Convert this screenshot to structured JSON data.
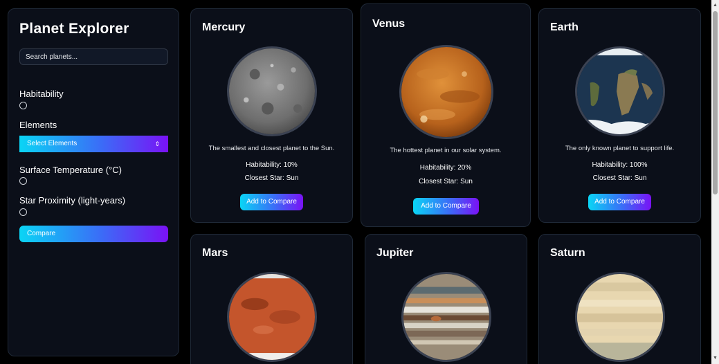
{
  "sidebar": {
    "title": "Planet Explorer",
    "search_placeholder": "Search planets...",
    "filters": {
      "habitability": "Habitability",
      "elements": "Elements",
      "elements_select": "Select Elements",
      "surface_temperature": "Surface Temperature (°C)",
      "star_proximity": "Star Proximity (light-years)"
    },
    "compare_label": "Compare"
  },
  "planets": [
    {
      "name": "Mercury",
      "description": "The smallest and closest planet to the Sun.",
      "habitability": "Habitability: 10%",
      "closest_star": "Closest Star: Sun",
      "button": "Add to Compare"
    },
    {
      "name": "Venus",
      "description": "The hottest planet in our solar system.",
      "habitability": "Habitability: 20%",
      "closest_star": "Closest Star: Sun",
      "button": "Add to Compare"
    },
    {
      "name": "Earth",
      "description": "The only known planet to support life.",
      "habitability": "Habitability: 100%",
      "closest_star": "Closest Star: Sun",
      "button": "Add to Compare"
    },
    {
      "name": "Mars"
    },
    {
      "name": "Jupiter"
    },
    {
      "name": "Saturn"
    }
  ],
  "colors": {
    "background": "#000000",
    "panel": "#0b0f19",
    "gradient_start": "#0ad5f5",
    "gradient_end": "#7a12f5"
  }
}
